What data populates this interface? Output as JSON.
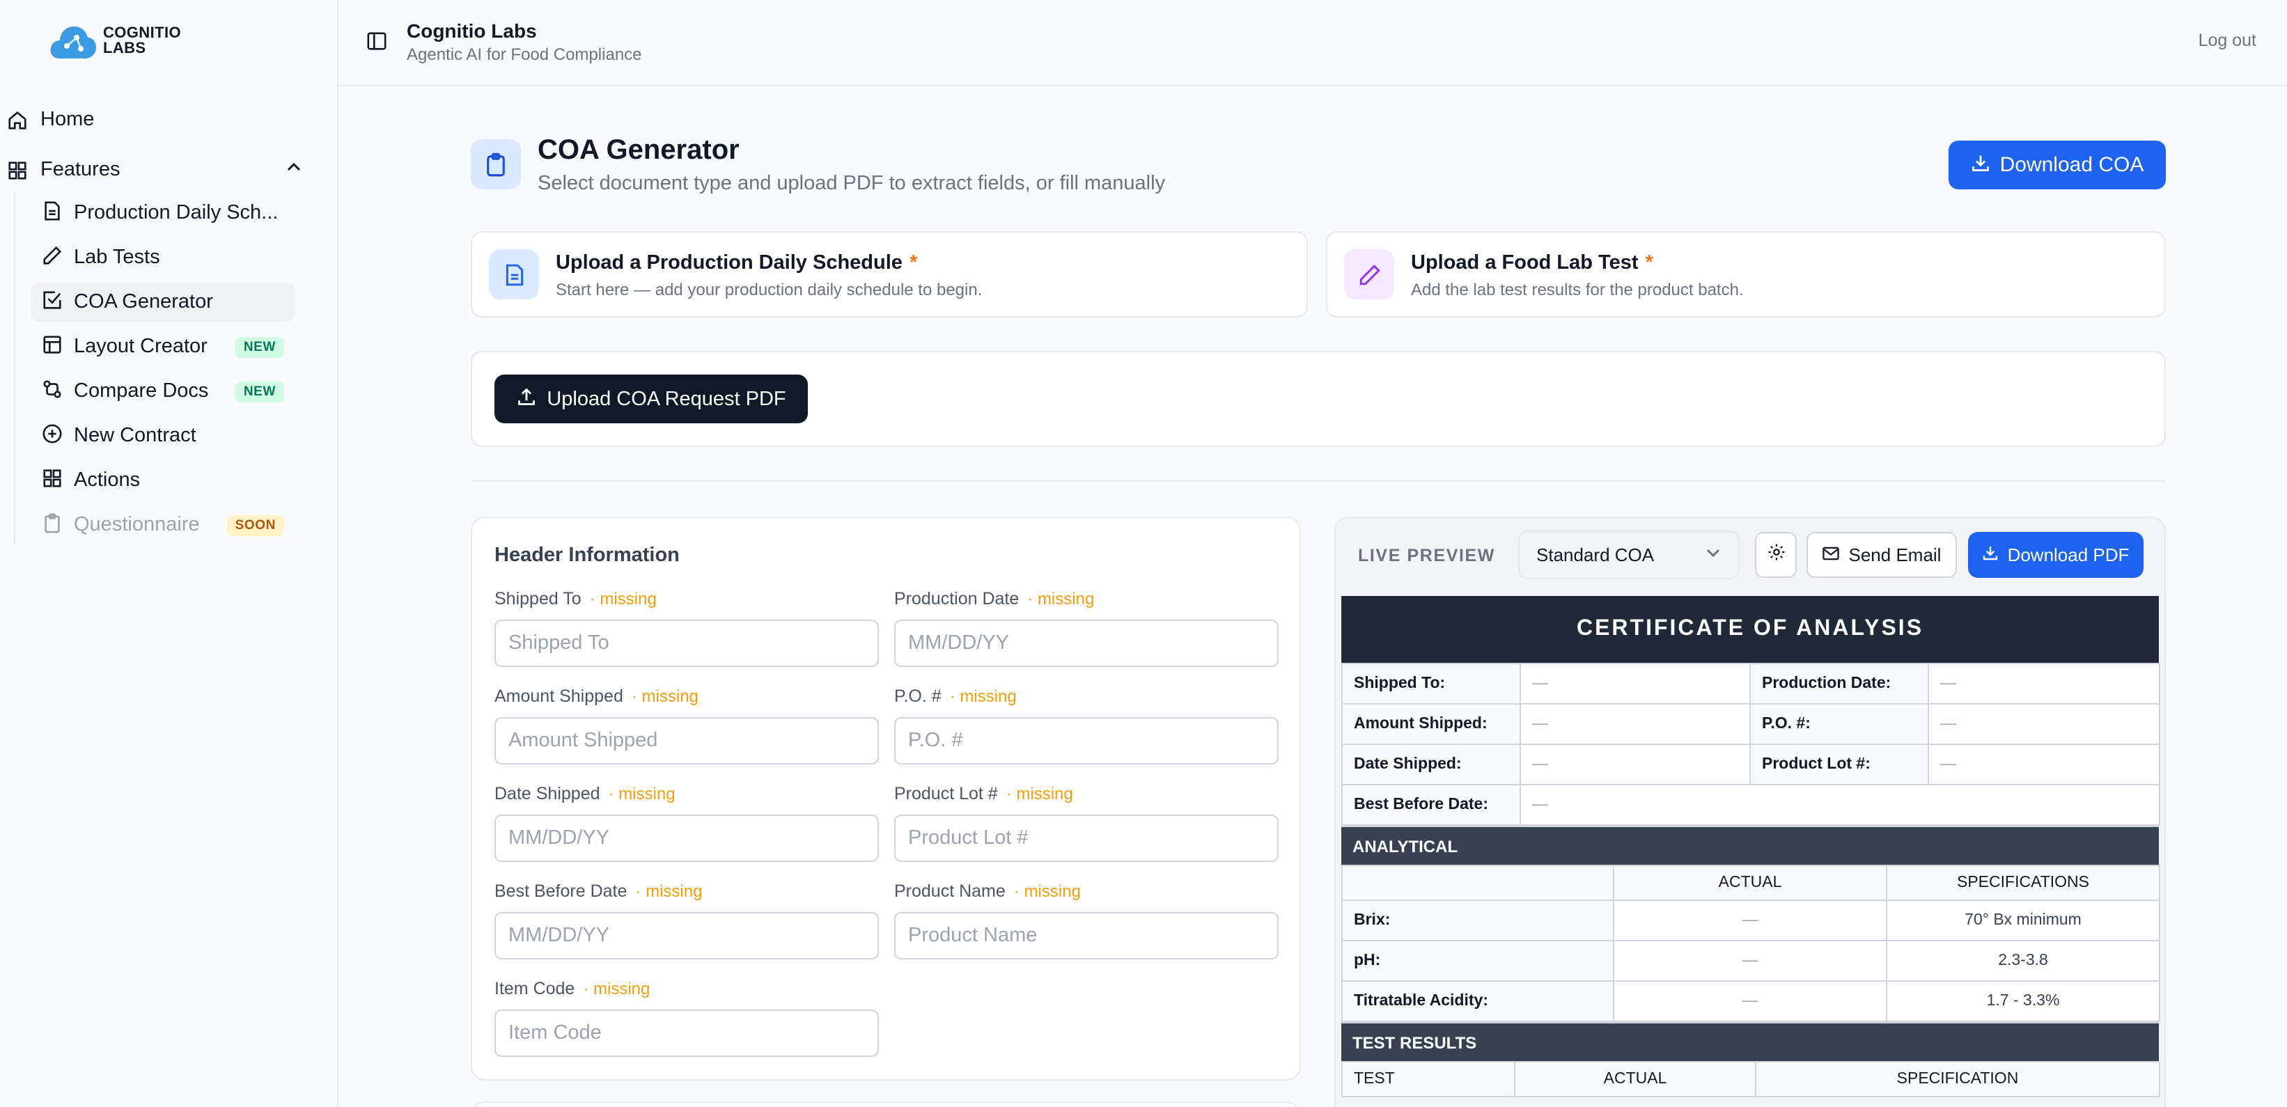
{
  "brand": {
    "logo_line1": "COGNITIO",
    "logo_line2": "LABS",
    "title": "Cognitio Labs",
    "subtitle": "Agentic AI for Food Compliance"
  },
  "topbar": {
    "logout": "Log out"
  },
  "sidebar": {
    "home": "Home",
    "features": "Features",
    "items": [
      {
        "label": "Production Daily Sch...",
        "icon": "document-icon"
      },
      {
        "label": "Lab Tests",
        "icon": "pen-icon"
      },
      {
        "label": "COA Generator",
        "icon": "checkbox-icon",
        "active": true
      },
      {
        "label": "Layout Creator",
        "icon": "layout-icon",
        "badge": "NEW"
      },
      {
        "label": "Compare Docs",
        "icon": "compare-icon",
        "badge": "NEW"
      },
      {
        "label": "New Contract",
        "icon": "plus-circle-icon"
      },
      {
        "label": "Actions",
        "icon": "grid-icon"
      },
      {
        "label": "Questionnaire",
        "icon": "clipboard-icon",
        "badge": "SOON",
        "disabled": true
      }
    ]
  },
  "page": {
    "title": "COA Generator",
    "subtitle": "Select document type and upload PDF to extract fields, or fill manually",
    "download_coa": "Download COA"
  },
  "uploads": [
    {
      "title": "Upload a Production Daily Schedule",
      "required": "*",
      "subtitle": "Start here — add your production daily schedule to begin."
    },
    {
      "title": "Upload a Food Lab Test",
      "required": "*",
      "subtitle": "Add the lab test results for the product batch."
    }
  ],
  "request": {
    "button": "Upload COA Request PDF"
  },
  "form": {
    "title": "Header Information",
    "missing": "· missing",
    "fields": [
      {
        "label": "Shipped To",
        "placeholder": "Shipped To"
      },
      {
        "label": "Production Date",
        "placeholder": "MM/DD/YY"
      },
      {
        "label": "Amount Shipped",
        "placeholder": "Amount Shipped"
      },
      {
        "label": "P.O. #",
        "placeholder": "P.O. #"
      },
      {
        "label": "Date Shipped",
        "placeholder": "MM/DD/YY"
      },
      {
        "label": "Product Lot #",
        "placeholder": "Product Lot #"
      },
      {
        "label": "Best Before Date",
        "placeholder": "MM/DD/YY"
      },
      {
        "label": "Product Name",
        "placeholder": "Product Name"
      },
      {
        "label": "Item Code",
        "placeholder": "Item Code"
      }
    ]
  },
  "preview": {
    "label": "LIVE PREVIEW",
    "template": "Standard COA",
    "send_email": "Send Email",
    "download_pdf": "Download PDF",
    "coa": {
      "heading": "CERTIFICATE OF ANALYSIS",
      "dash": "—",
      "header_rows": [
        [
          "Shipped To:",
          "Production Date:"
        ],
        [
          "Amount Shipped:",
          "P.O. #:"
        ],
        [
          "Date Shipped:",
          "Product Lot #:"
        ]
      ],
      "best_before": "Best Before Date:",
      "analytical_title": "ANALYTICAL",
      "analytical_cols": [
        "ACTUAL",
        "SPECIFICATIONS"
      ],
      "analytical_rows": [
        {
          "name": "Brix:",
          "spec": "70° Bx minimum"
        },
        {
          "name": "pH:",
          "spec": "2.3-3.8"
        },
        {
          "name": "Titratable Acidity:",
          "spec": "1.7 - 3.3%"
        }
      ],
      "tests_title": "TEST RESULTS",
      "tests_cols": [
        "TEST",
        "ACTUAL",
        "SPECIFICATION"
      ]
    }
  }
}
